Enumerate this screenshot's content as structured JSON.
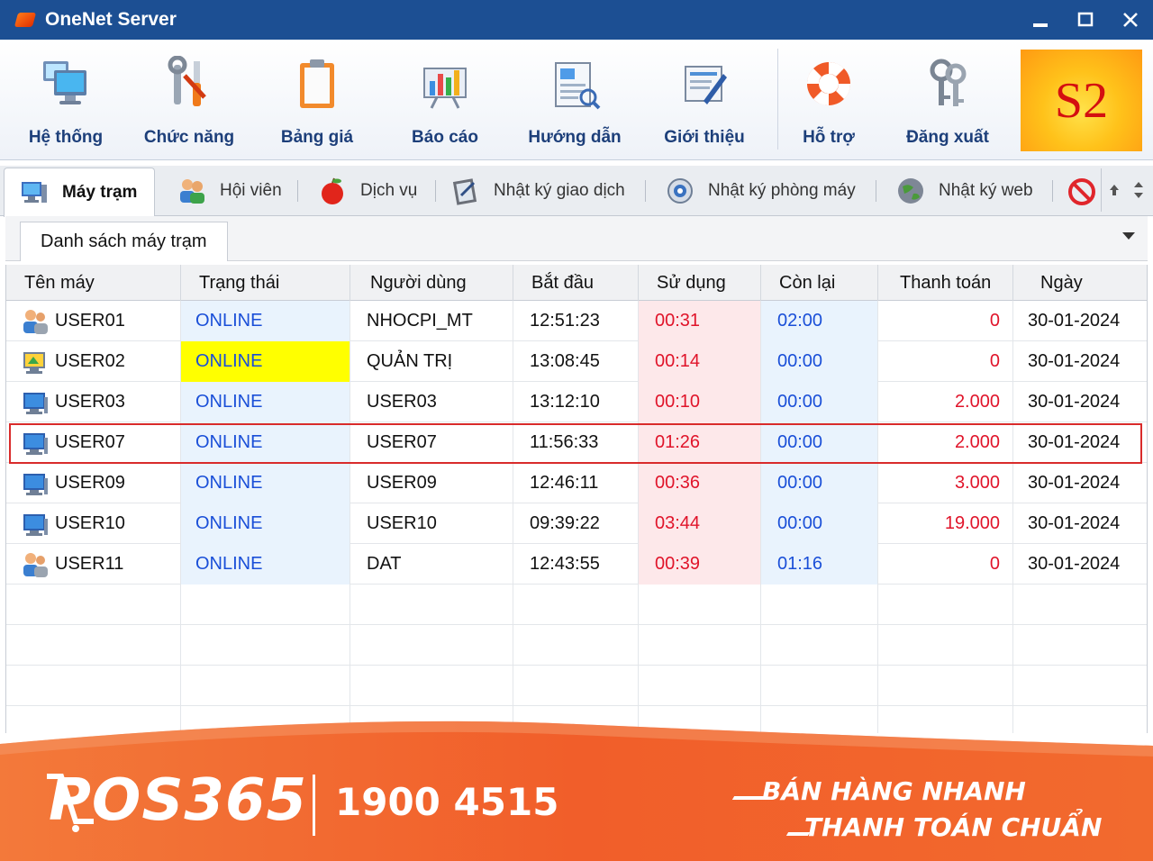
{
  "window": {
    "title": "OneNet Server"
  },
  "toolbar": {
    "items": [
      {
        "label": "Hệ thống",
        "icon": "monitor-system-icon"
      },
      {
        "label": "Chức năng",
        "icon": "tools-icon"
      },
      {
        "label": "Bảng giá",
        "icon": "clipboard-icon"
      },
      {
        "label": "Báo cáo",
        "icon": "report-chart-icon"
      },
      {
        "label": "Hướng dẫn",
        "icon": "guide-document-icon"
      },
      {
        "label": "Giới thiệu",
        "icon": "about-document-icon"
      },
      {
        "label": "Hỗ trợ",
        "icon": "lifebuoy-icon"
      },
      {
        "label": "Đăng xuất",
        "icon": "keys-icon"
      }
    ],
    "logo_text": "S2"
  },
  "tabs": [
    {
      "label": "Máy trạm",
      "icon": "workstation-icon",
      "active": true
    },
    {
      "label": "Hội viên",
      "icon": "members-icon"
    },
    {
      "label": "Dịch vụ",
      "icon": "apple-icon"
    },
    {
      "label": "Nhật ký giao dịch",
      "icon": "transaction-log-icon"
    },
    {
      "label": "Nhật ký phòng máy",
      "icon": "room-log-icon"
    },
    {
      "label": "Nhật ký web",
      "icon": "globe-icon"
    }
  ],
  "panel": {
    "title": "Danh sách máy trạm"
  },
  "table": {
    "headers": [
      "Tên máy",
      "Trạng thái",
      "Người dùng",
      "Bắt đầu",
      "Sử dụng",
      "Còn lại",
      "Thanh toán",
      "Ngày"
    ],
    "rows": [
      {
        "name": "USER01",
        "icon": "member-user-icon",
        "status": "ONLINE",
        "user": "NHOCPI_MT",
        "start": "12:51:23",
        "used": "00:31",
        "remaining": "02:00",
        "payment": "0",
        "date": "30-01-2024"
      },
      {
        "name": "USER02",
        "icon": "admin-computer-icon",
        "status": "ONLINE",
        "status_highlight": true,
        "user": "QUẢN TRỊ",
        "start": "13:08:45",
        "used": "00:14",
        "remaining": "00:00",
        "payment": "0",
        "date": "30-01-2024"
      },
      {
        "name": "USER03",
        "icon": "computer-icon",
        "status": "ONLINE",
        "user": "USER03",
        "start": "13:12:10",
        "used": "00:10",
        "remaining": "00:00",
        "payment": "2.000",
        "date": "30-01-2024"
      },
      {
        "name": "USER07",
        "icon": "computer-icon",
        "status": "ONLINE",
        "user": "USER07",
        "start": "11:56:33",
        "used": "01:26",
        "remaining": "00:00",
        "payment": "2.000",
        "date": "30-01-2024",
        "selected": true
      },
      {
        "name": "USER09",
        "icon": "computer-icon",
        "status": "ONLINE",
        "user": "USER09",
        "start": "12:46:11",
        "used": "00:36",
        "remaining": "00:00",
        "payment": "3.000",
        "date": "30-01-2024"
      },
      {
        "name": "USER10",
        "icon": "computer-icon",
        "status": "ONLINE",
        "user": "USER10",
        "start": "09:39:22",
        "used": "03:44",
        "remaining": "00:00",
        "payment": "19.000",
        "date": "30-01-2024"
      },
      {
        "name": "USER11",
        "icon": "member-user-icon",
        "status": "ONLINE",
        "user": "DAT",
        "start": "12:43:55",
        "used": "00:39",
        "remaining": "01:16",
        "payment": "0",
        "date": "30-01-2024"
      }
    ]
  },
  "banner": {
    "brand": "POS365",
    "hotline": "1900 4515",
    "slogan_line1": "BÁN HÀNG NHANH",
    "slogan_line2": "THANH TOÁN CHUẨN"
  },
  "colors": {
    "titlebar": "#1c4f93",
    "status_text": "#1a4fd8",
    "time_used_text": "#e0142a",
    "payment_text": "#e0142a",
    "status_highlight_bg": "#ffff00",
    "selected_row_border": "#d92b2b",
    "banner_orange": "#f26a2e"
  }
}
